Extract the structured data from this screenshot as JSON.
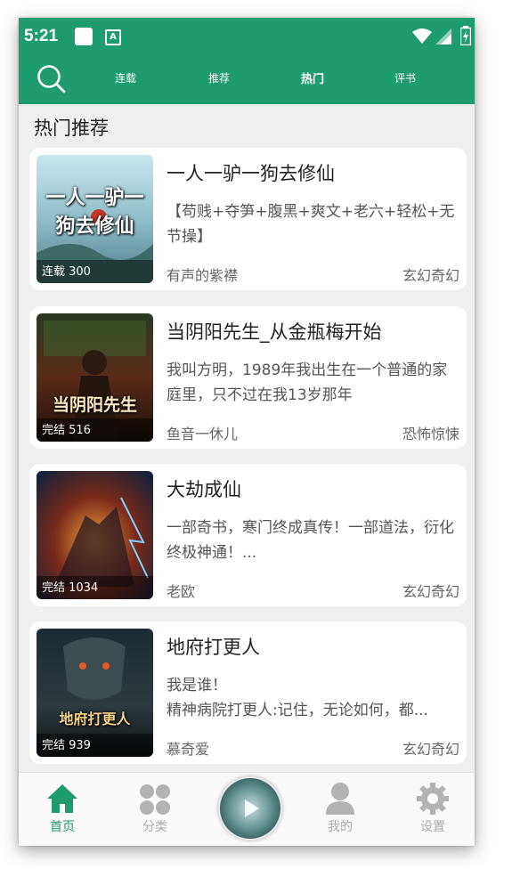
{
  "status_bar": {
    "time": "5:21"
  },
  "nav": {
    "tabs": [
      {
        "label": "连载",
        "active": false
      },
      {
        "label": "推荐",
        "active": false
      },
      {
        "label": "热门",
        "active": true
      },
      {
        "label": "评书",
        "active": false
      }
    ],
    "search_icon": "search-icon"
  },
  "section": {
    "title": "热门推荐"
  },
  "books": [
    {
      "title": "一人一驴一狗去修仙",
      "description": "【苟贱+夺笋+腹黑+爽文+老六+轻松+无节操】",
      "author": "有声的紫襟",
      "genre": "玄幻奇幻",
      "badge": "连载 300",
      "cover_text": "一人一驴一狗去修仙"
    },
    {
      "title": "当阴阳先生_从金瓶梅开始",
      "description": "我叫方明，1989年我出生在一个普通的家庭里，只不过在我13岁那年",
      "author": "鱼音一休儿",
      "genre": "恐怖惊悚",
      "badge": "完结 516",
      "cover_text": "当阴阳先生"
    },
    {
      "title": "大劫成仙",
      "description": "一部奇书，寒门终成真传！一部道法，衍化终极神通！...",
      "author": "老欧",
      "genre": "玄幻奇幻",
      "badge": "完结 1034",
      "cover_text": ""
    },
    {
      "title": "地府打更人",
      "description": "我是谁！\n精神病院打更人:记住，无论如何，都...",
      "author": "慕奇爱",
      "genre": "玄幻奇幻",
      "badge": "完结 939",
      "cover_text": "地府打更人"
    }
  ],
  "bottom_nav": [
    {
      "label": "首页",
      "icon": "home-icon",
      "active": true
    },
    {
      "label": "分类",
      "icon": "category-icon",
      "active": false
    },
    {
      "label": "",
      "icon": "player-cover",
      "active": false
    },
    {
      "label": "我的",
      "icon": "user-icon",
      "active": false
    },
    {
      "label": "设置",
      "icon": "gear-icon",
      "active": false
    }
  ],
  "colors": {
    "accent": "#1e9c6e",
    "background": "#efefef",
    "card": "#ffffff",
    "inactive": "#aaaaaa"
  }
}
